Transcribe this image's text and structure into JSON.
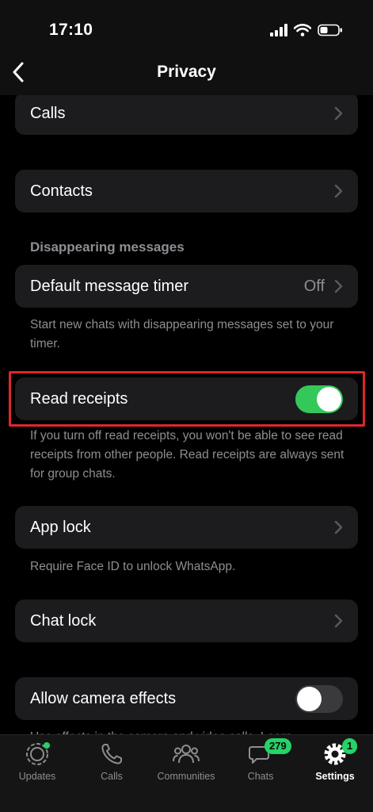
{
  "status_bar": {
    "time": "17:10"
  },
  "nav": {
    "title": "Privacy"
  },
  "rows": {
    "calls": "Calls",
    "contacts": "Contacts",
    "default_timer": {
      "label": "Default message timer",
      "value": "Off"
    },
    "read_receipts": {
      "label": "Read receipts",
      "enabled": true
    },
    "app_lock": "App lock",
    "chat_lock": "Chat lock",
    "camera_effects": {
      "label": "Allow camera effects",
      "enabled": false
    }
  },
  "sections": {
    "disappearing": "Disappearing messages"
  },
  "footnotes": {
    "disappearing": "Start new chats with disappearing messages set to your timer.",
    "read_receipts": "If you turn off read receipts, you won't be able to see read receipts from other people. Read receipts are always sent for group chats.",
    "app_lock": "Require Face ID to unlock WhatsApp.",
    "camera_effects": "Use effects in the camera and video calls. Learn"
  },
  "tabs": [
    {
      "label": "Updates"
    },
    {
      "label": "Calls"
    },
    {
      "label": "Communities"
    },
    {
      "label": "Chats",
      "badge": "279"
    },
    {
      "label": "Settings",
      "badge": "1"
    }
  ],
  "colors": {
    "accent_green": "#34c759",
    "badge_green": "#25d366",
    "highlight_red": "#e0262e",
    "card_bg": "#1c1c1e"
  }
}
